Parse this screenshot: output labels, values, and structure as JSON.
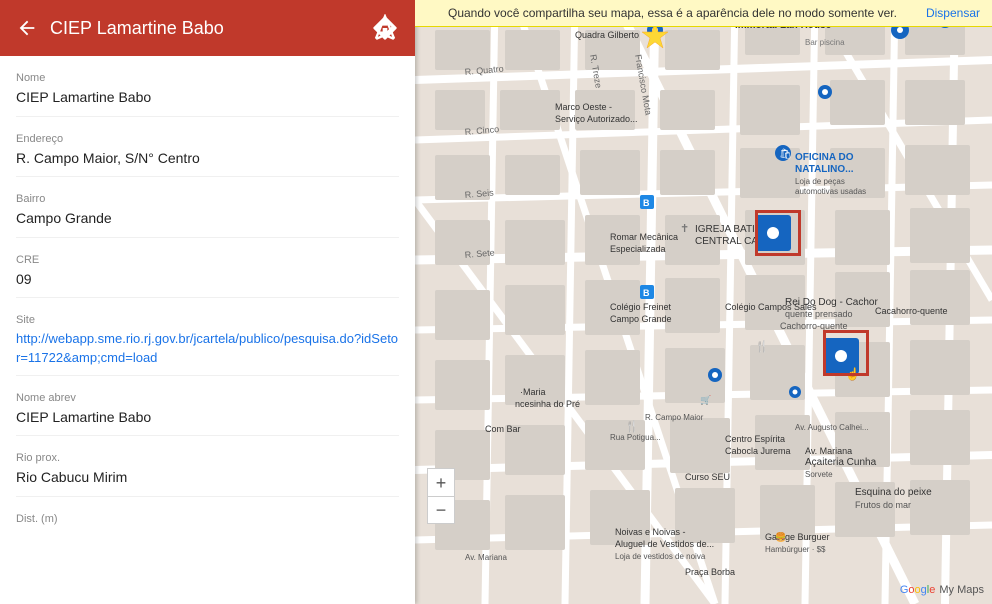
{
  "header": {
    "title": "CIEP Lamartine Babo",
    "back_label": "←",
    "directions_label": "directions"
  },
  "banner": {
    "text": "Quando você compartilha seu mapa, essa é a aparência dele no modo somente ver.",
    "dismiss_label": "Dispensar"
  },
  "fields": {
    "nome_label": "Nome",
    "nome_value": "CIEP Lamartine Babo",
    "endereco_label": "Endereço",
    "endereco_value": "R. Campo Maior, S/N° Centro",
    "bairro_label": "Bairro",
    "bairro_value": "Campo Grande",
    "cre_label": "CRE",
    "cre_value": "09",
    "site_label": "Site",
    "site_value": "http://webapp.sme.rio.rj.gov.br/jcartela/publico/pesquisa.do?idSetor=11722&amp;cmd=load",
    "nome_abrev_label": "Nome abrev",
    "nome_abrev_value": "CIEP Lamartine Babo",
    "rio_prox_label": "Rio prox.",
    "rio_prox_value": "Rio Cabucu Mirim",
    "dist_label": "Dist. (m)"
  },
  "map": {
    "immortal_lan_house": "Immortal Lan House"
  },
  "zoom": {
    "in_label": "+",
    "out_label": "−"
  },
  "google": {
    "logo": "Google My Maps"
  }
}
